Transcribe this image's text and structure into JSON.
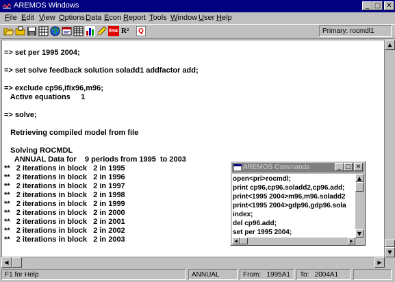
{
  "window": {
    "title": "AREMOS Windows"
  },
  "title_buttons": {
    "minimize": "_",
    "maximize": "□",
    "close": "✕"
  },
  "menu": [
    {
      "underline": "F",
      "rest": "ile"
    },
    {
      "underline": "E",
      "rest": "dit"
    },
    {
      "underline": "V",
      "rest": "iew"
    },
    {
      "underline": "O",
      "rest": "ptions"
    },
    {
      "underline": "D",
      "rest": "ata"
    },
    {
      "underline": "E",
      "rest": "con"
    },
    {
      "underline": "R",
      "rest": "eport"
    },
    {
      "underline": "T",
      "rest": "ools"
    },
    {
      "underline": "W",
      "rest": "indow"
    },
    {
      "underline": "U",
      "rest": "ser"
    },
    {
      "underline": "H",
      "rest": "elp"
    }
  ],
  "toolbar": {
    "icons": [
      "open-folder-icon",
      "folder-icon",
      "save-icon",
      "grid-icon",
      "globe-icon",
      "window-icon",
      "table-icon",
      "bar-chart-icon",
      "pencil-icon",
      "data-icon",
      "r-squared-icon",
      "quit-icon"
    ],
    "data_label": "$%£",
    "r2_label": "R²",
    "q_label": "Q",
    "primary": "Primary: rocmdl1"
  },
  "output_lines": [
    "=> set per 1995 2004;",
    "",
    "=> set solve feedback solution soladd1 addfactor add;",
    "",
    "=> exclude cp96,ifix96,m96;",
    "   Active equations     1",
    "",
    "=> solve;",
    "",
    "   Retrieving compiled model from file",
    "",
    "   Solving ROCMDL",
    "     ANNUAL Data for    9 periods from 1995  to 2003",
    "**   2 iterations in block   2 in 1995",
    "**   2 iterations in block   2 in 1996",
    "**   2 iterations in block   2 in 1997",
    "**   2 iterations in block   2 in 1998",
    "**   2 iterations in block   2 in 1999",
    "**   2 iterations in block   2 in 2000",
    "**   2 iterations in block   2 in 2001",
    "**   2 iterations in block   2 in 2002",
    "**   2 iterations in block   2 in 2003"
  ],
  "commands_window": {
    "title": "AREMOS Commands",
    "lines": [
      "open<pri>rocmdl;",
      "print cp96,cp96.soladd2,cp96.add;",
      "print<1995 2004>m96,m96.soladd2",
      "print<1995 2004>gdp96,gdp96.sola",
      "index;",
      "del cp96.add;",
      "set per 1995 2004;"
    ]
  },
  "status": {
    "help": "F1 for Help",
    "freq": "ANNUAL",
    "from_label": "From:",
    "from_value": "1995A1",
    "to_label": "To:",
    "to_value": "2004A1"
  },
  "scroll_arrows": {
    "up": "▲",
    "down": "▼",
    "left": "◀",
    "right": "▶"
  },
  "colors": {
    "titlebar": "#000080",
    "inactive_titlebar": "#808080",
    "face": "#c0c0c0"
  }
}
